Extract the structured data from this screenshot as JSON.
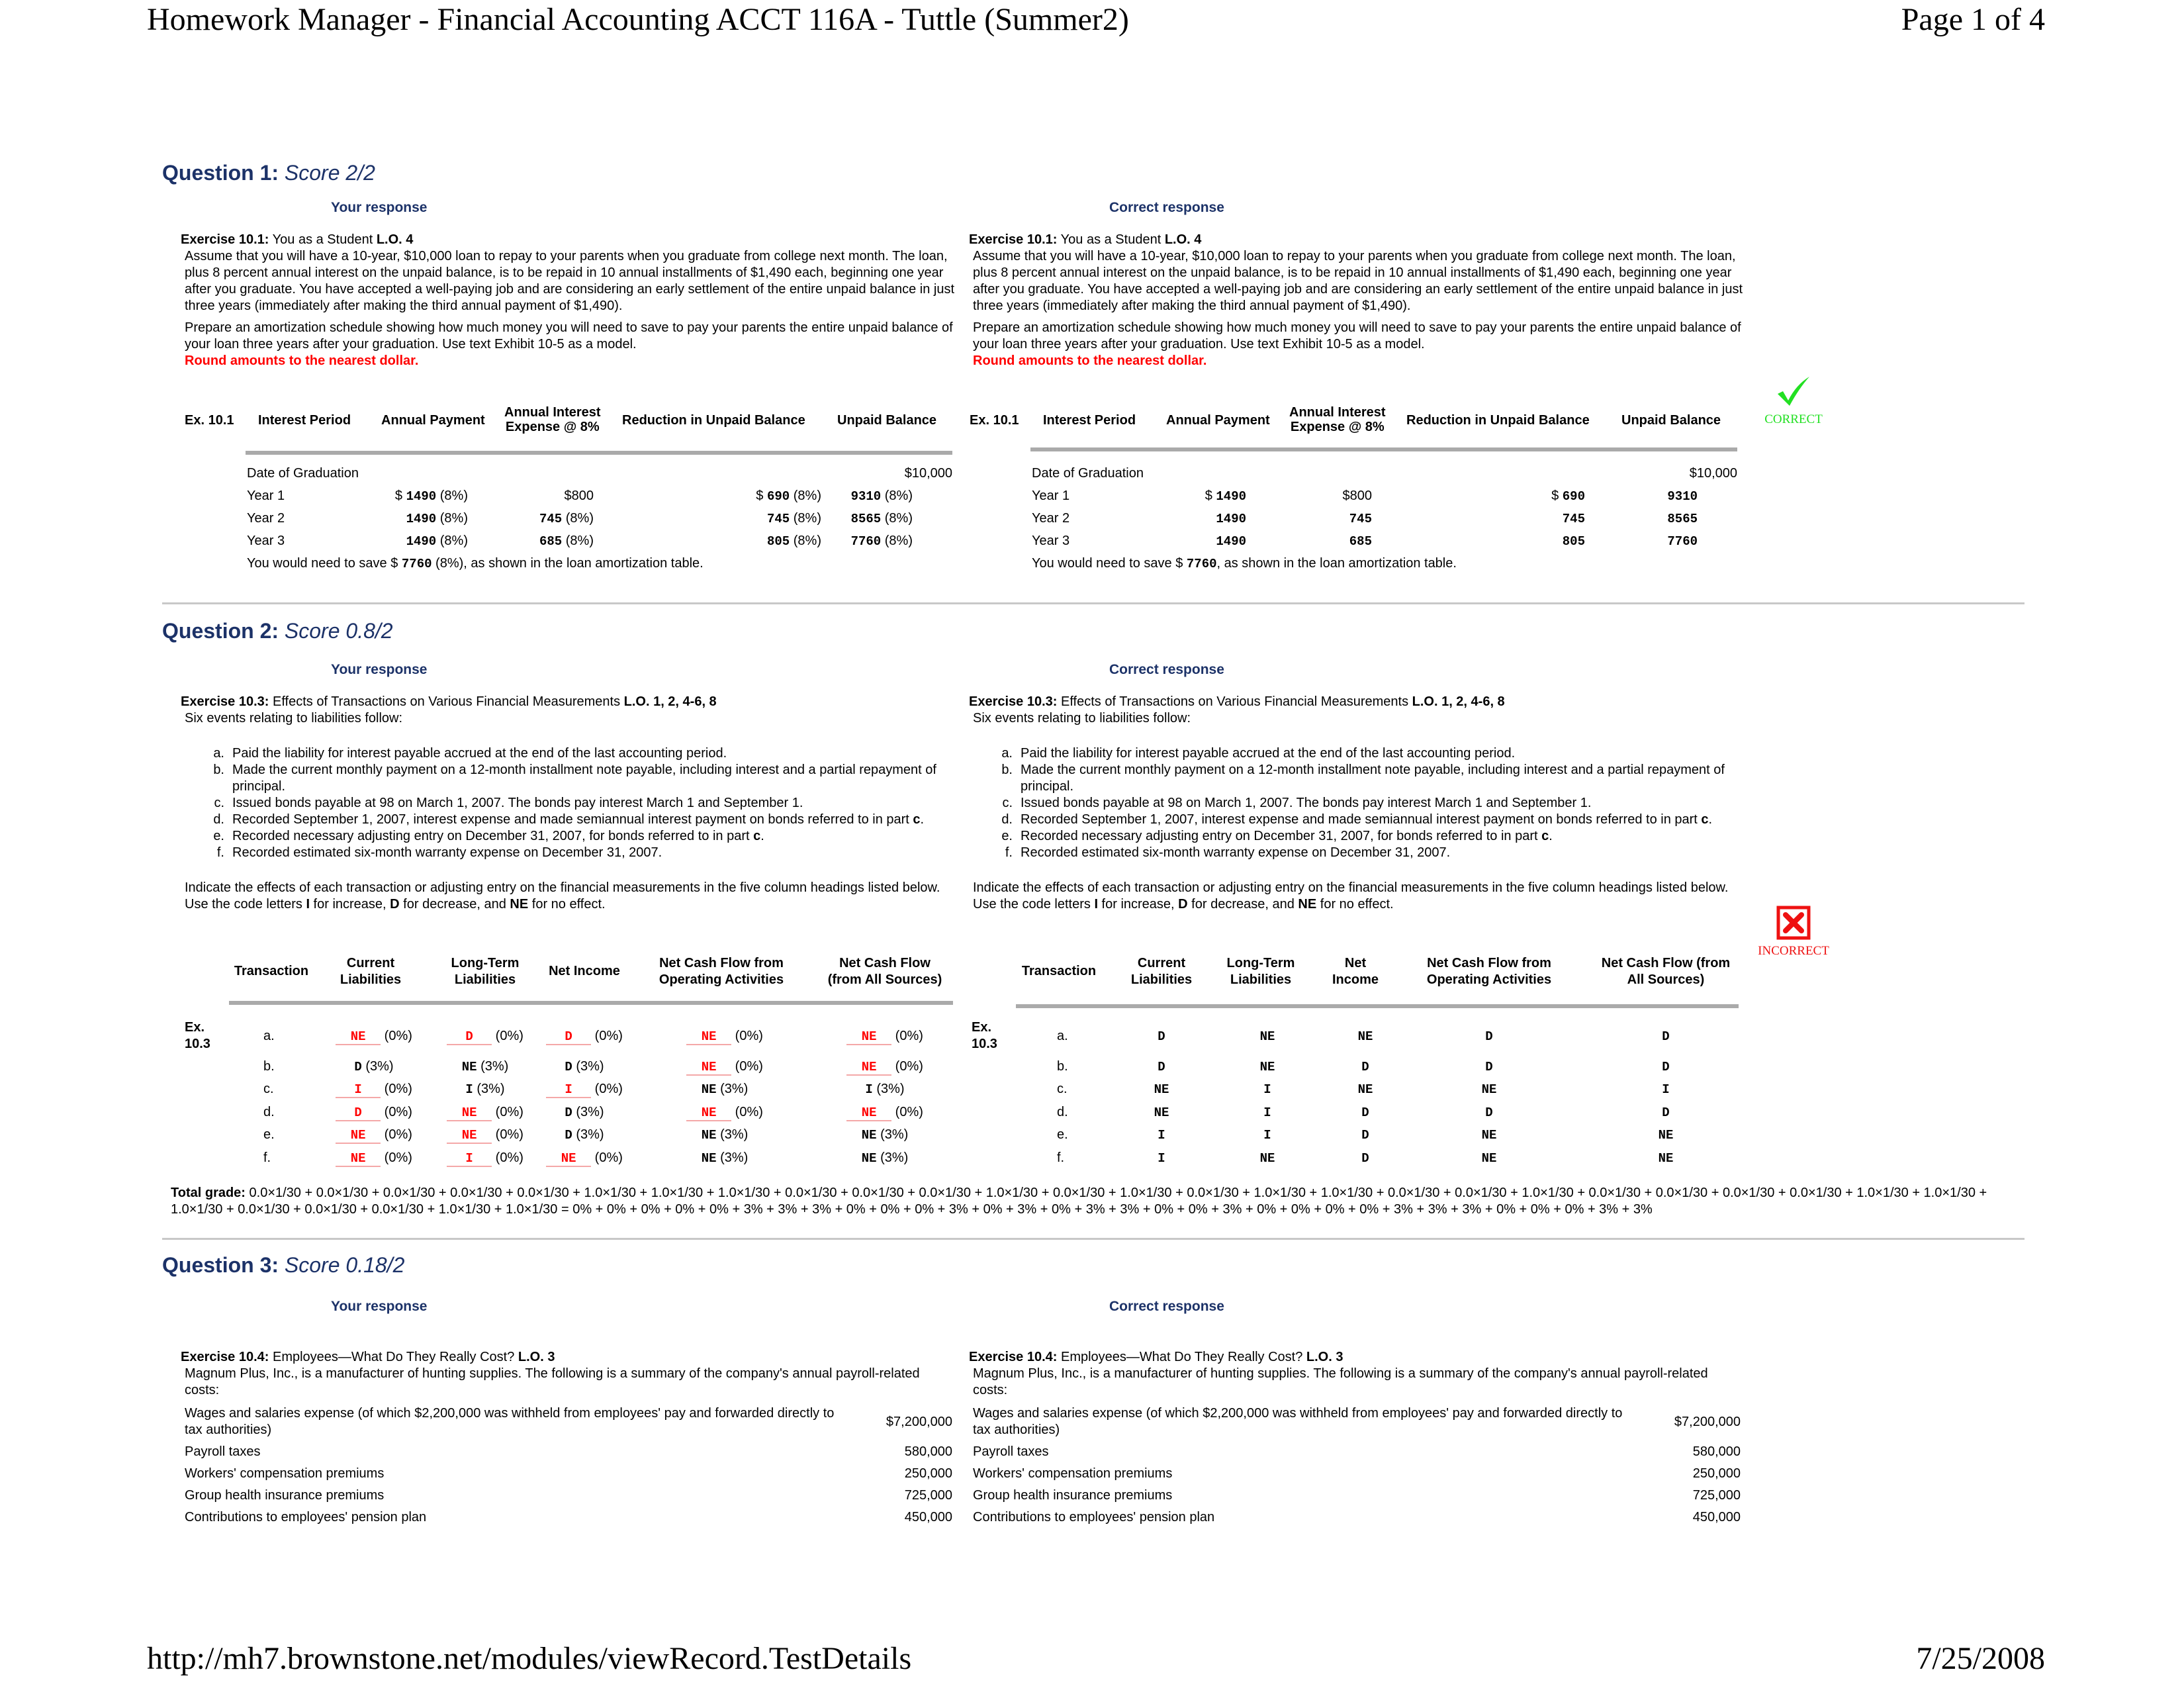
{
  "header": {
    "title": "Homework Manager - Financial Accounting ACCT 116A - Tuttle (Summer2)",
    "page": "Page 1 of 4"
  },
  "footer": {
    "url": "http://mh7.brownstone.net/modules/viewRecord.TestDetails",
    "date": "7/25/2008"
  },
  "labels": {
    "your_response": "Your response",
    "correct_response": "Correct response"
  },
  "q1": {
    "title": "Question 1:",
    "score": "Score 2/2",
    "exercise_bold": "Exercise 10.1:",
    "exercise_title": " You as a Student ",
    "exercise_lo": "L.O. 4",
    "para1": "Assume that you will have a 10-year, $10,000 loan to repay to your parents when you graduate from college next month. The loan, plus 8 percent annual interest on the unpaid balance, is to be repaid in 10 annual installments of $1,490 each, beginning one year after you graduate. You have accepted a well-paying job and are considering an early settlement of the entire unpaid balance in just three years (immediately after making the third annual payment of $1,490).",
    "para2": "Prepare an amortization schedule showing how much money you will need to save to pay your parents the entire unpaid balance of your loan three years after your graduation. Use text Exhibit 10-5 as a model.",
    "note": "Round amounts to the nearest dollar.",
    "headers": [
      "Ex. 10.1",
      "Interest Period",
      "Annual Payment",
      "Annual Interest Expense @ 8%",
      "Reduction in Unpaid Balance",
      "Unpaid Balance"
    ],
    "header_interest_l1": "Annual Interest",
    "header_interest_l2": "Expense @ 8%",
    "graduation_label": "Date of Graduation",
    "graduation_balance": "$10,000",
    "your_rows": [
      {
        "period": "Year 1",
        "payment_prefix": "$ ",
        "payment": "1490",
        "payment_pct": " (8%)",
        "interest": "$800",
        "interest_pct": "",
        "reduction_prefix": "$ ",
        "reduction": "690",
        "reduction_pct": " (8%)",
        "balance": "9310",
        "balance_pct": " (8%)"
      },
      {
        "period": "Year 2",
        "payment_prefix": "",
        "payment": "1490",
        "payment_pct": " (8%)",
        "interest": "745",
        "interest_pct": " (8%)",
        "reduction_prefix": "",
        "reduction": "745",
        "reduction_pct": " (8%)",
        "balance": "8565",
        "balance_pct": " (8%)"
      },
      {
        "period": "Year 3",
        "payment_prefix": "",
        "payment": "1490",
        "payment_pct": " (8%)",
        "interest": "685",
        "interest_pct": " (8%)",
        "reduction_prefix": "",
        "reduction": "805",
        "reduction_pct": " (8%)",
        "balance": "7760",
        "balance_pct": " (8%)"
      }
    ],
    "correct_rows": [
      {
        "period": "Year 1",
        "payment_prefix": "$ ",
        "payment": "1490",
        "interest": "$800",
        "reduction_prefix": "$ ",
        "reduction": "690",
        "balance": "9310"
      },
      {
        "period": "Year 2",
        "payment_prefix": "",
        "payment": "1490",
        "interest": "745",
        "reduction_prefix": "",
        "reduction": "745",
        "balance": "8565"
      },
      {
        "period": "Year 3",
        "payment_prefix": "",
        "payment": "1490",
        "interest": "685",
        "reduction_prefix": "",
        "reduction": "805",
        "balance": "7760"
      }
    ],
    "save_prefix": "You would need to save $ ",
    "save_value": "7760",
    "your_save_pct": " (8%)",
    "save_suffix": ", as shown in the loan amortization table.",
    "badge": "CORRECT",
    "badge_color": "#22e022"
  },
  "q2": {
    "title": "Question 2:",
    "score": "Score 0.8/2",
    "exercise_bold": "Exercise 10.3:",
    "exercise_title": " Effects of Transactions on Various Financial Measurements ",
    "exercise_lo": "L.O. 1, 2, 4-6, 8",
    "intro": "Six events relating to liabilities follow:",
    "events": [
      {
        "letter": "a.",
        "text": "Paid the liability for interest payable accrued at the end of the last accounting period."
      },
      {
        "letter": "b.",
        "text": "Made the current monthly payment on a 12-month installment note payable, including interest and a partial repayment of principal."
      },
      {
        "letter": "c.",
        "text": "Issued bonds payable at 98 on March 1, 2007. The bonds pay interest March 1 and September 1."
      },
      {
        "letter": "d.",
        "text": "Recorded September 1, 2007, interest expense and made semiannual interest payment on bonds referred to in part ",
        "bold_tail": "c",
        "tail": "."
      },
      {
        "letter": "e.",
        "text": "Recorded necessary adjusting entry on December 31, 2007, for bonds referred to in part ",
        "bold_tail": "c",
        "tail": "."
      },
      {
        "letter": "f.",
        "text": "Recorded estimated six-month warranty expense on December 31, 2007."
      }
    ],
    "instr_1": "Indicate the effects of each transaction or adjusting entry on the financial measurements in the five column headings listed below. Use the code letters ",
    "instr_I": "I",
    "instr_2": " for increase, ",
    "instr_D": "D",
    "instr_3": " for decrease, and ",
    "instr_NE": "NE",
    "instr_4": " for no effect.",
    "your_headers": [
      [
        "Transaction",
        ""
      ],
      [
        "Current",
        "Liabilities"
      ],
      [
        "Long-Term",
        "Liabilities"
      ],
      [
        "Net Income",
        ""
      ],
      [
        "Net Cash Flow from",
        "Operating Activities"
      ],
      [
        "Net Cash Flow",
        "(from All Sources)"
      ]
    ],
    "correct_headers": [
      [
        "Transaction",
        ""
      ],
      [
        "Current",
        "Liabilities"
      ],
      [
        "Long-Term",
        "Liabilities"
      ],
      [
        "Net",
        "Income"
      ],
      [
        "Net Cash Flow from",
        "Operating Activities"
      ],
      [
        "Net Cash Flow (from",
        "All Sources)"
      ]
    ],
    "ex_label_1": "Ex.",
    "ex_label_2": "10.3",
    "your_rows": [
      {
        "letter": "a.",
        "cells": [
          {
            "v": "NE",
            "p": "(0%)",
            "w": true
          },
          {
            "v": "D",
            "p": "(0%)",
            "w": true
          },
          {
            "v": "D",
            "p": "(0%)",
            "w": true
          },
          {
            "v": "NE",
            "p": "(0%)",
            "w": true
          },
          {
            "v": "NE",
            "p": "(0%)",
            "w": true
          }
        ]
      },
      {
        "letter": "b.",
        "cells": [
          {
            "v": "D",
            "p": "(3%)",
            "w": false
          },
          {
            "v": "NE",
            "p": "(3%)",
            "w": false
          },
          {
            "v": "D",
            "p": "(3%)",
            "w": false
          },
          {
            "v": "NE",
            "p": "(0%)",
            "w": true
          },
          {
            "v": "NE",
            "p": "(0%)",
            "w": true
          }
        ]
      },
      {
        "letter": "c.",
        "cells": [
          {
            "v": "I",
            "p": "(0%)",
            "w": true
          },
          {
            "v": "I",
            "p": "(3%)",
            "w": false
          },
          {
            "v": "I",
            "p": "(0%)",
            "w": true
          },
          {
            "v": "NE",
            "p": "(3%)",
            "w": false
          },
          {
            "v": "I",
            "p": "(3%)",
            "w": false
          }
        ]
      },
      {
        "letter": "d.",
        "cells": [
          {
            "v": "D",
            "p": "(0%)",
            "w": true
          },
          {
            "v": "NE",
            "p": "(0%)",
            "w": true
          },
          {
            "v": "D",
            "p": "(3%)",
            "w": false
          },
          {
            "v": "NE",
            "p": "(0%)",
            "w": true
          },
          {
            "v": "NE",
            "p": "(0%)",
            "w": true
          }
        ]
      },
      {
        "letter": "e.",
        "cells": [
          {
            "v": "NE",
            "p": "(0%)",
            "w": true
          },
          {
            "v": "NE",
            "p": "(0%)",
            "w": true
          },
          {
            "v": "D",
            "p": "(3%)",
            "w": false
          },
          {
            "v": "NE",
            "p": "(3%)",
            "w": false
          },
          {
            "v": "NE",
            "p": "(3%)",
            "w": false
          }
        ]
      },
      {
        "letter": "f.",
        "cells": [
          {
            "v": "NE",
            "p": "(0%)",
            "w": true
          },
          {
            "v": "I",
            "p": "(0%)",
            "w": true
          },
          {
            "v": "NE",
            "p": "(0%)",
            "w": true
          },
          {
            "v": "NE",
            "p": "(3%)",
            "w": false
          },
          {
            "v": "NE",
            "p": "(3%)",
            "w": false
          }
        ]
      }
    ],
    "correct_rows": [
      {
        "letter": "a.",
        "cells": [
          "D",
          "NE",
          "NE",
          "D",
          "D"
        ]
      },
      {
        "letter": "b.",
        "cells": [
          "D",
          "NE",
          "D",
          "D",
          "D"
        ]
      },
      {
        "letter": "c.",
        "cells": [
          "NE",
          "I",
          "NE",
          "NE",
          "I"
        ]
      },
      {
        "letter": "d.",
        "cells": [
          "NE",
          "I",
          "D",
          "D",
          "D"
        ]
      },
      {
        "letter": "e.",
        "cells": [
          "I",
          "I",
          "D",
          "NE",
          "NE"
        ]
      },
      {
        "letter": "f.",
        "cells": [
          "I",
          "NE",
          "D",
          "NE",
          "NE"
        ]
      }
    ],
    "total_label": "Total grade:",
    "total_text": " 0.0×1/30 + 0.0×1/30 + 0.0×1/30 + 0.0×1/30 + 0.0×1/30 + 1.0×1/30 + 1.0×1/30 + 1.0×1/30 + 0.0×1/30 + 0.0×1/30 + 0.0×1/30 + 1.0×1/30 + 0.0×1/30 + 1.0×1/30 + 0.0×1/30 + 1.0×1/30 + 1.0×1/30 + 0.0×1/30 + 0.0×1/30 + 1.0×1/30 + 0.0×1/30 + 0.0×1/30 + 0.0×1/30 + 0.0×1/30 + 1.0×1/30 + 1.0×1/30 + 1.0×1/30 + 0.0×1/30 + 0.0×1/30 + 0.0×1/30 + 1.0×1/30 + 1.0×1/30 = 0% + 0% + 0% + 0% + 0% + 3% + 3% + 3% + 0% + 0% + 0% + 3% + 0% + 3% + 0% + 3% + 3% + 0% + 0% + 3% + 0% + 0% + 0% + 0% + 3% + 3% + 3% + 0% + 0% + 0% + 3% + 3%",
    "badge": "INCORRECT",
    "badge_color": "#ee1111"
  },
  "q3": {
    "title": "Question 3:",
    "score": "Score 0.18/2",
    "exercise_bold": "Exercise 10.4:",
    "exercise_title": " Employees—What Do They Really Cost? ",
    "exercise_lo": "L.O. 3",
    "intro": "Magnum Plus, Inc., is a manufacturer of hunting supplies. The following is a summary of the company's annual payroll-related costs:",
    "items": [
      {
        "label": "Wages and salaries expense (of which $2,200,000 was withheld from employees' pay and forwarded directly to tax authorities)",
        "amount": "$7,200,000"
      },
      {
        "label": "Payroll taxes",
        "amount": "580,000"
      },
      {
        "label": "Workers' compensation premiums",
        "amount": "250,000"
      },
      {
        "label": "Group health insurance premiums",
        "amount": "725,000"
      },
      {
        "label": "Contributions to employees' pension plan",
        "amount": "450,000"
      }
    ]
  }
}
